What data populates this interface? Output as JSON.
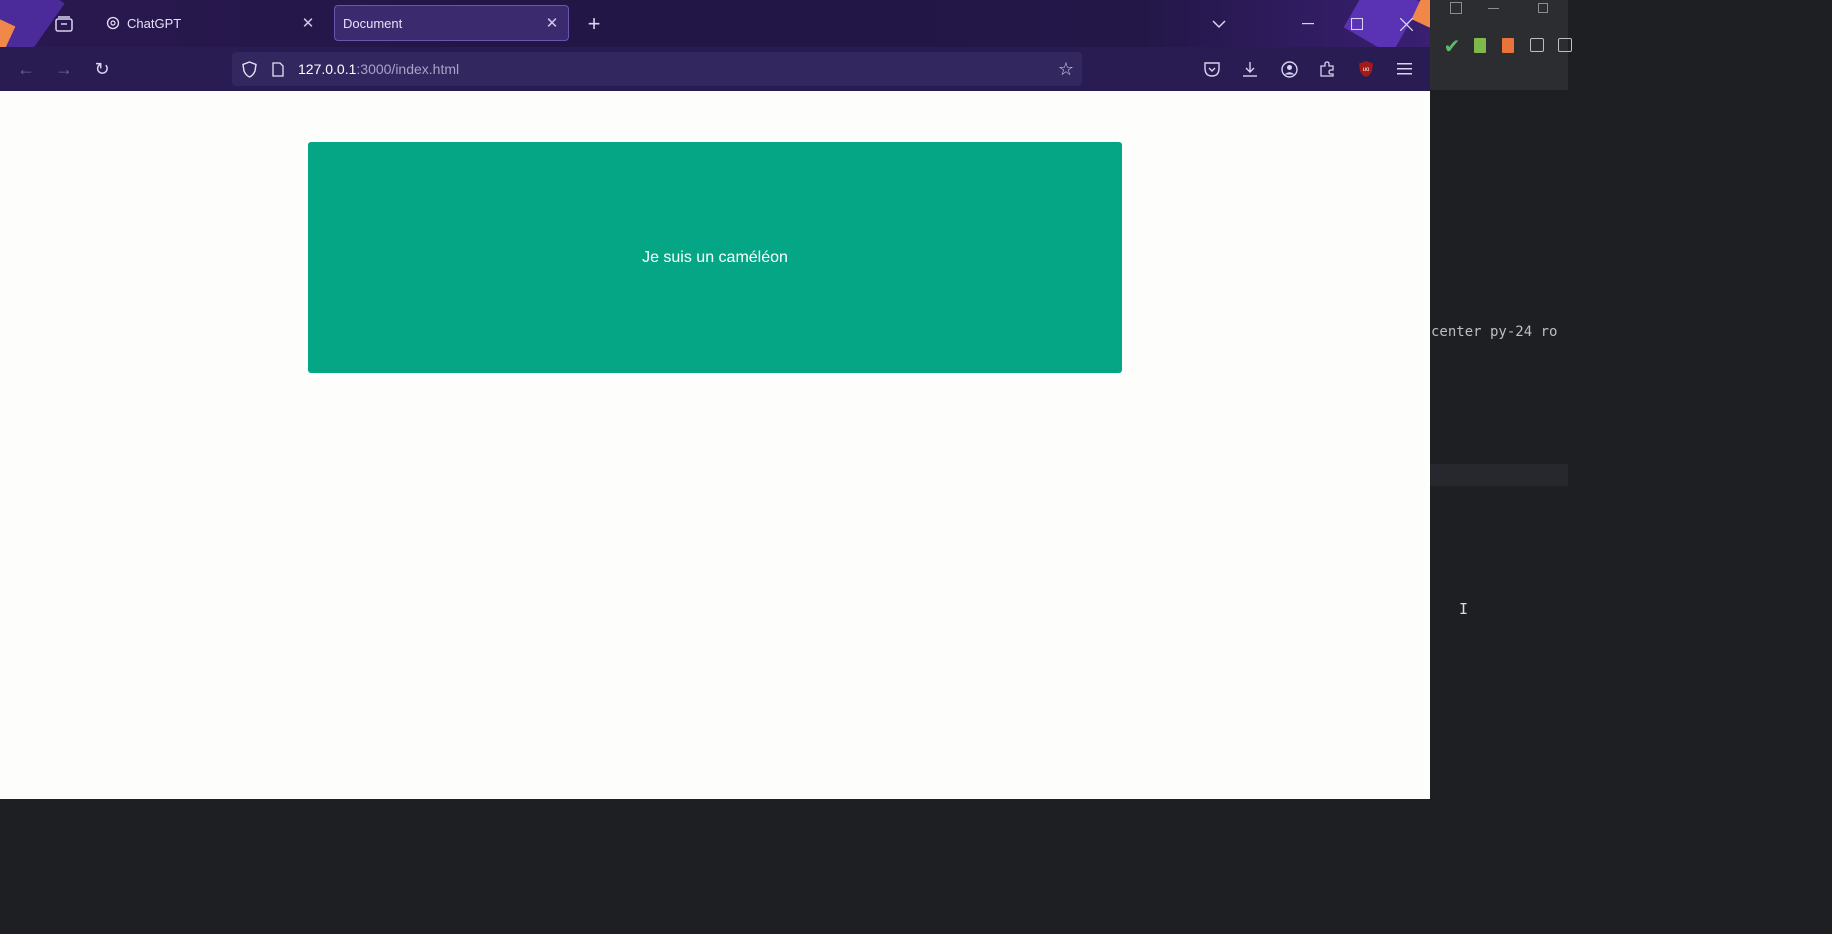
{
  "browser": {
    "tabs": [
      {
        "title": "ChatGPT",
        "favicon": "openai-icon",
        "active": false
      },
      {
        "title": "Document",
        "favicon": "",
        "active": true
      }
    ],
    "url": {
      "host": "127.0.0.1",
      "path": ":3000/index.html"
    },
    "accent_color": "#05a685"
  },
  "page": {
    "card_text": "Je suis un caméléon",
    "card_color": "#05a685"
  },
  "editor": {
    "code_line": "center py-24 ro",
    "theme_color": "#1e1f22"
  }
}
